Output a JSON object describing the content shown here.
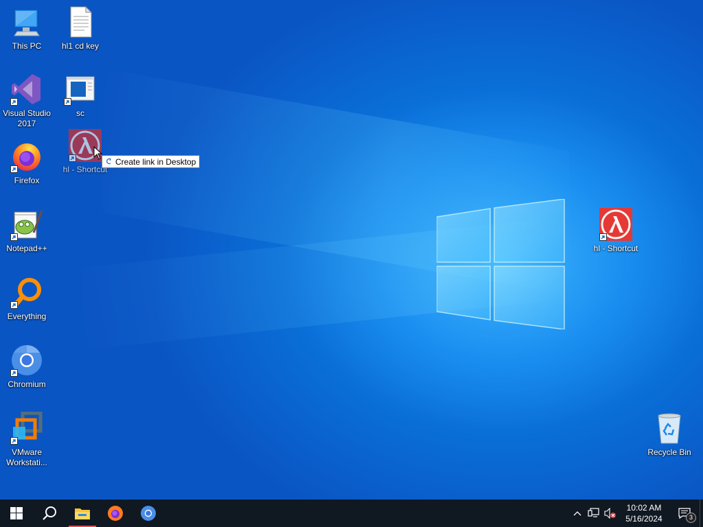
{
  "desktop": {
    "icons": [
      {
        "label": "This PC"
      },
      {
        "label": "hl1 cd key"
      },
      {
        "label": "Visual Studio 2017"
      },
      {
        "label": "sc"
      },
      {
        "label": "Firefox"
      },
      {
        "label": "hl - Shortcut"
      },
      {
        "label": "Notepad++"
      },
      {
        "label": "Everything"
      },
      {
        "label": "Chromium"
      },
      {
        "label": "VMware Workstati..."
      },
      {
        "label": "hl - Shortcut"
      },
      {
        "label": "Recycle Bin"
      }
    ],
    "drag_tooltip": "Create link in Desktop"
  },
  "taskbar": {
    "pinned": [
      "start-icon",
      "search-icon",
      "file-explorer-icon",
      "firefox-icon",
      "chromium-icon"
    ],
    "clock": {
      "time": "10:02 AM",
      "date": "5/16/2024"
    },
    "notification_count": "3"
  },
  "colors": {
    "taskbar": "#101822",
    "accent": "#0a6fd8"
  }
}
